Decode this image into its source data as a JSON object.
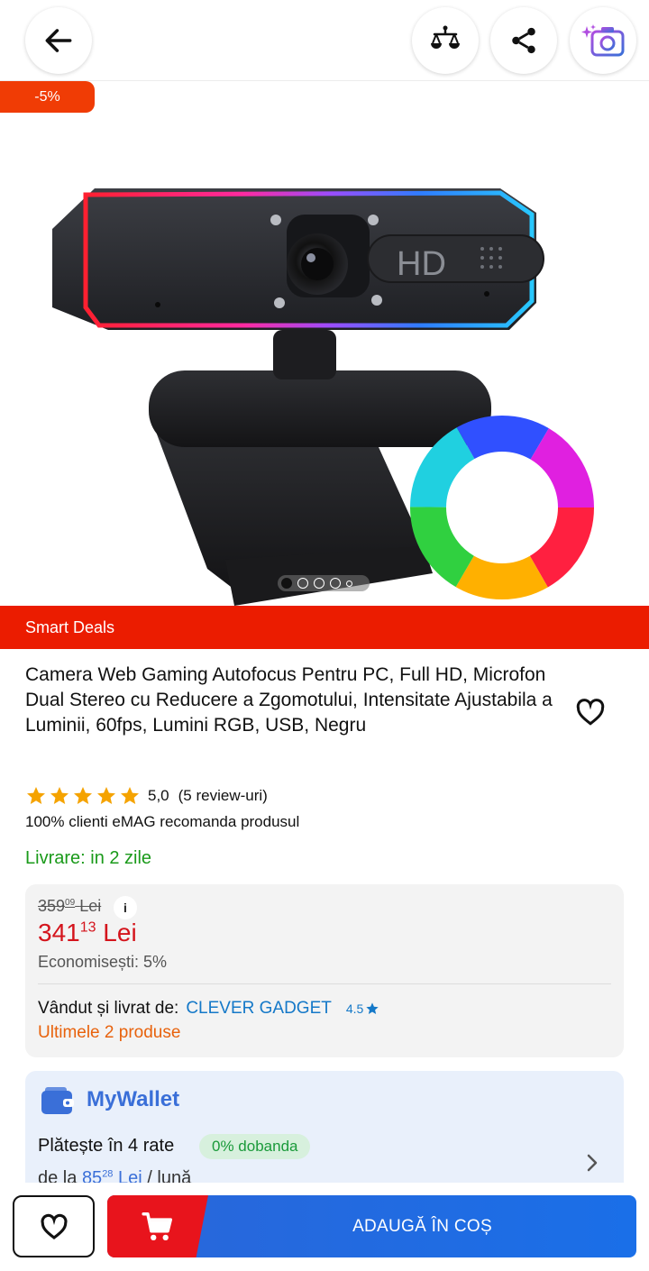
{
  "header": {
    "back_icon": "arrow-left-icon",
    "compare_icon": "scale-compare-icon",
    "share_icon": "share-icon",
    "camera_search_icon": "camera-search-icon"
  },
  "product": {
    "discount_badge": "-5%",
    "deal_label": "Smart Deals",
    "title": "Camera Web Gaming Autofocus Pentru PC, Full HD, Microfon Dual Stereo cu Reducere a Zgomotului, Intensitate Ajustabila a Luminii, 60fps, Lumini RGB, USB, Negru",
    "image_camera_text": "HD",
    "gallery": {
      "count": 5,
      "active_index": 0
    },
    "rating": {
      "stars": 5,
      "value": "5,0",
      "reviews": "(5 review-uri)"
    },
    "recommend": "100% clienti eMAG recomanda produsul",
    "delivery": "Livrare: in 2 zile"
  },
  "price": {
    "old_int": "359",
    "old_dec": "09",
    "old_currency": "Lei",
    "info": "i",
    "new_int": "341",
    "new_dec": "13",
    "new_currency": "Lei",
    "savings": "Economisești: 5%",
    "seller_label": "Vândut și livrat de:",
    "seller_name": "CLEVER GADGET",
    "seller_rating": "4.5",
    "stock": "Ultimele 2 produse"
  },
  "wallet": {
    "title": "MyWallet",
    "installments": "Plătește în 4 rate",
    "interest_badge": "0% dobanda",
    "from_prefix": "de la",
    "from_int": "85",
    "from_dec": "28",
    "from_currency": "Lei",
    "from_suffix": "/ lună"
  },
  "bottom": {
    "add_to_cart": "ADAUGĂ ÎN COȘ"
  },
  "colors": {
    "accent_red": "#eb1c00",
    "price_red": "#d4141c",
    "link_blue": "#1478c8",
    "delivery_green": "#1a9a1a",
    "stock_orange": "#e8620c",
    "cart_blue": "#1a6fe8"
  }
}
